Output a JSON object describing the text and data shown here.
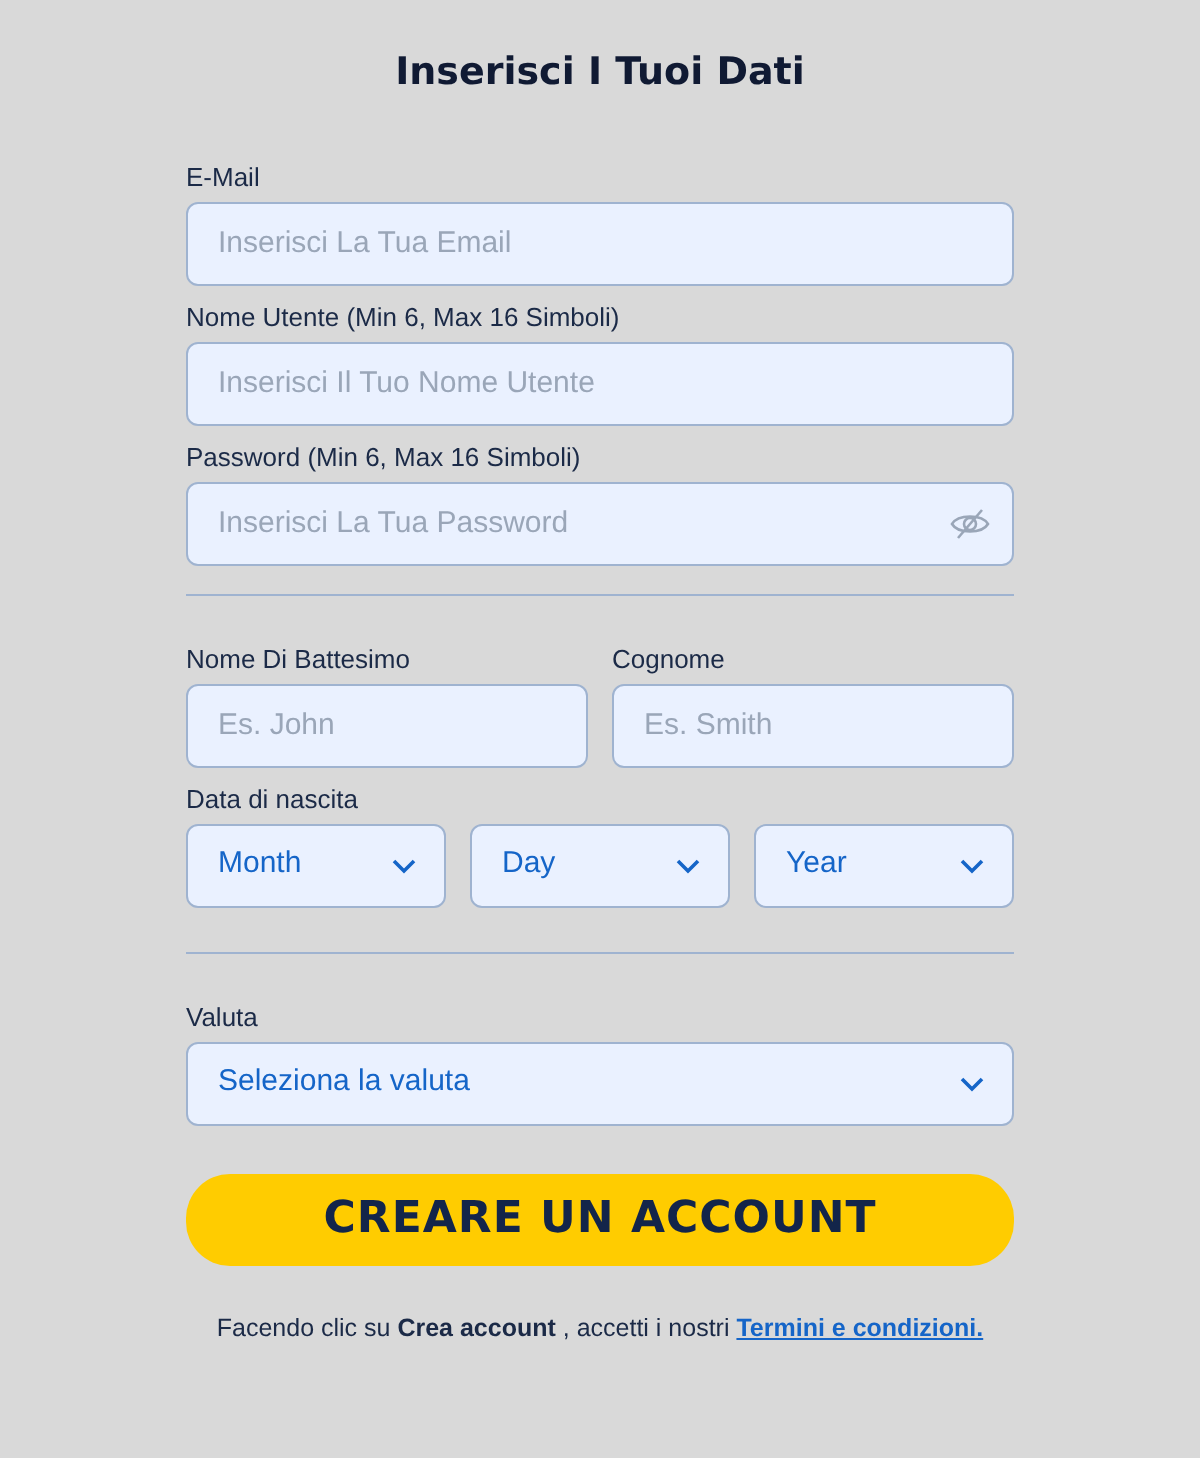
{
  "title": "Inserisci I Tuoi Dati",
  "account_fields": [
    {
      "label": "E-Mail",
      "placeholder": "Inserisci La Tua Email",
      "kind": "text"
    },
    {
      "label": "Nome Utente (Min 6, Max 16 Simboli)",
      "placeholder": "Inserisci Il Tuo Nome Utente",
      "kind": "text"
    },
    {
      "label": "Password (Min 6, Max 16 Simboli)",
      "placeholder": "Inserisci La Tua Password",
      "kind": "password"
    }
  ],
  "name_fields": [
    {
      "label": "Nome Di Battesimo",
      "placeholder": "Es. John"
    },
    {
      "label": "Cognome",
      "placeholder": "Es. Smith"
    }
  ],
  "birth_date": {
    "label": "Data di nascita",
    "selects": [
      "Month",
      "Day",
      "Year"
    ]
  },
  "currency": {
    "label": "Valuta",
    "value": "Seleziona la valuta"
  },
  "submit_button": "CREARE UN ACCOUNT",
  "terms": {
    "text": "Facendo clic su **Crea account** , accetti i nostri",
    "link": "Termini e condizioni."
  }
}
